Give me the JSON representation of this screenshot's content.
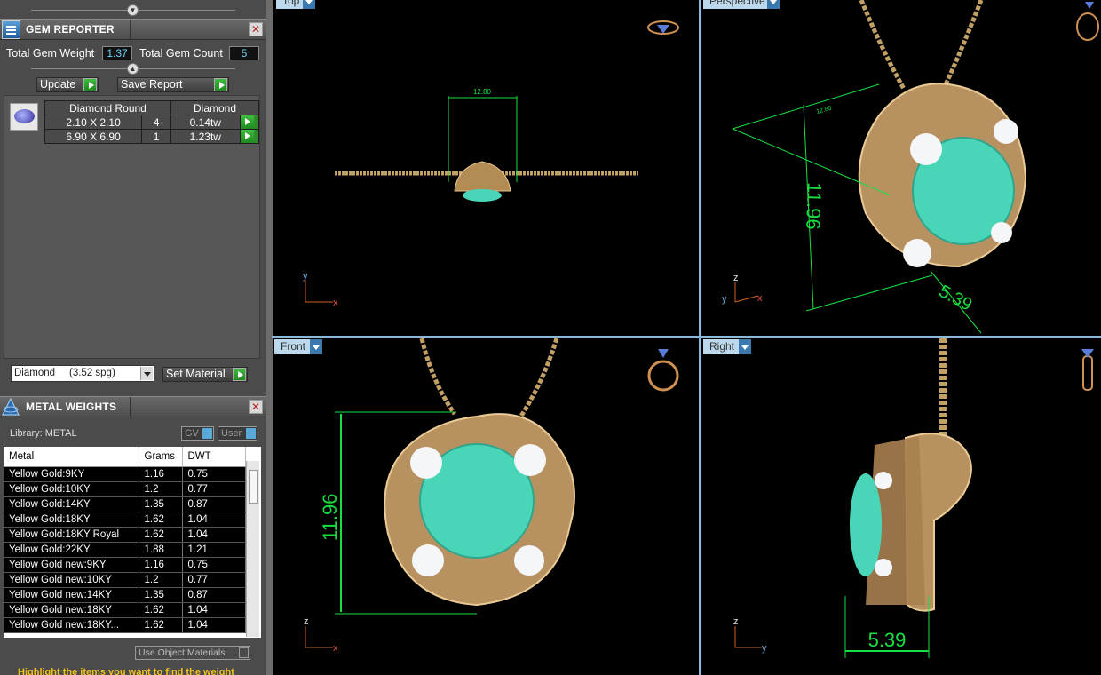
{
  "gem_reporter": {
    "title": "GEM REPORTER",
    "total_weight_label": "Total Gem Weight",
    "total_weight": "1.37",
    "total_count_label": "Total Gem Count",
    "total_count": "5",
    "update_label": "Update",
    "save_report_label": "Save Report",
    "gem_shape": "Diamond Round",
    "gem_material": "Diamond",
    "rows": [
      {
        "size": "2.10 X 2.10",
        "count": "4",
        "weight": "0.14tw"
      },
      {
        "size": "6.90 X 6.90",
        "count": "1",
        "weight": "1.23tw"
      }
    ],
    "material_select": "Diamond     (3.52 spg)",
    "set_material_label": "Set Material"
  },
  "metal_weights": {
    "title": "METAL WEIGHTS",
    "library_label": "Library: METAL",
    "gv_label": "GV",
    "user_label": "User",
    "columns": [
      "Metal",
      "Grams",
      "DWT"
    ],
    "rows": [
      [
        "Yellow Gold:9KY",
        "1.16",
        "0.75"
      ],
      [
        "Yellow Gold:10KY",
        "1.2",
        "0.77"
      ],
      [
        "Yellow Gold:14KY",
        "1.35",
        "0.87"
      ],
      [
        "Yellow Gold:18KY",
        "1.62",
        "1.04"
      ],
      [
        "Yellow Gold:18KY Royal",
        "1.62",
        "1.04"
      ],
      [
        "Yellow Gold:22KY",
        "1.88",
        "1.21"
      ],
      [
        "Yellow Gold new:9KY",
        "1.16",
        "0.75"
      ],
      [
        "Yellow Gold new:10KY",
        "1.2",
        "0.77"
      ],
      [
        "Yellow Gold new:14KY",
        "1.35",
        "0.87"
      ],
      [
        "Yellow Gold new:18KY",
        "1.62",
        "1.04"
      ],
      [
        "Yellow Gold new:18KY...",
        "1.62",
        "1.04"
      ]
    ],
    "use_object_materials_label": "Use Object Materials",
    "hint_text": "Highlight the items you want to find the weight"
  },
  "viewports": {
    "top": {
      "label": "Top",
      "dimension": "12.80",
      "axes": [
        "y",
        "x"
      ]
    },
    "perspective": {
      "label": "Perspective",
      "dim_height": "11.96",
      "dim_width": "5.39",
      "small_dim": "12.80",
      "axes": [
        "z",
        "y",
        "x"
      ]
    },
    "front": {
      "label": "Front",
      "dim_height": "11.96",
      "axes": [
        "z",
        "x"
      ]
    },
    "right": {
      "label": "Right",
      "dim_width": "5.39",
      "axes": [
        "z",
        "y"
      ]
    }
  },
  "colors": {
    "panel_bg": "#4b4b4b",
    "dimension_green": "#16e040",
    "gold": "#c9a46a",
    "emerald": "#49d6b8",
    "viewport_label": "#bcd8ec"
  }
}
